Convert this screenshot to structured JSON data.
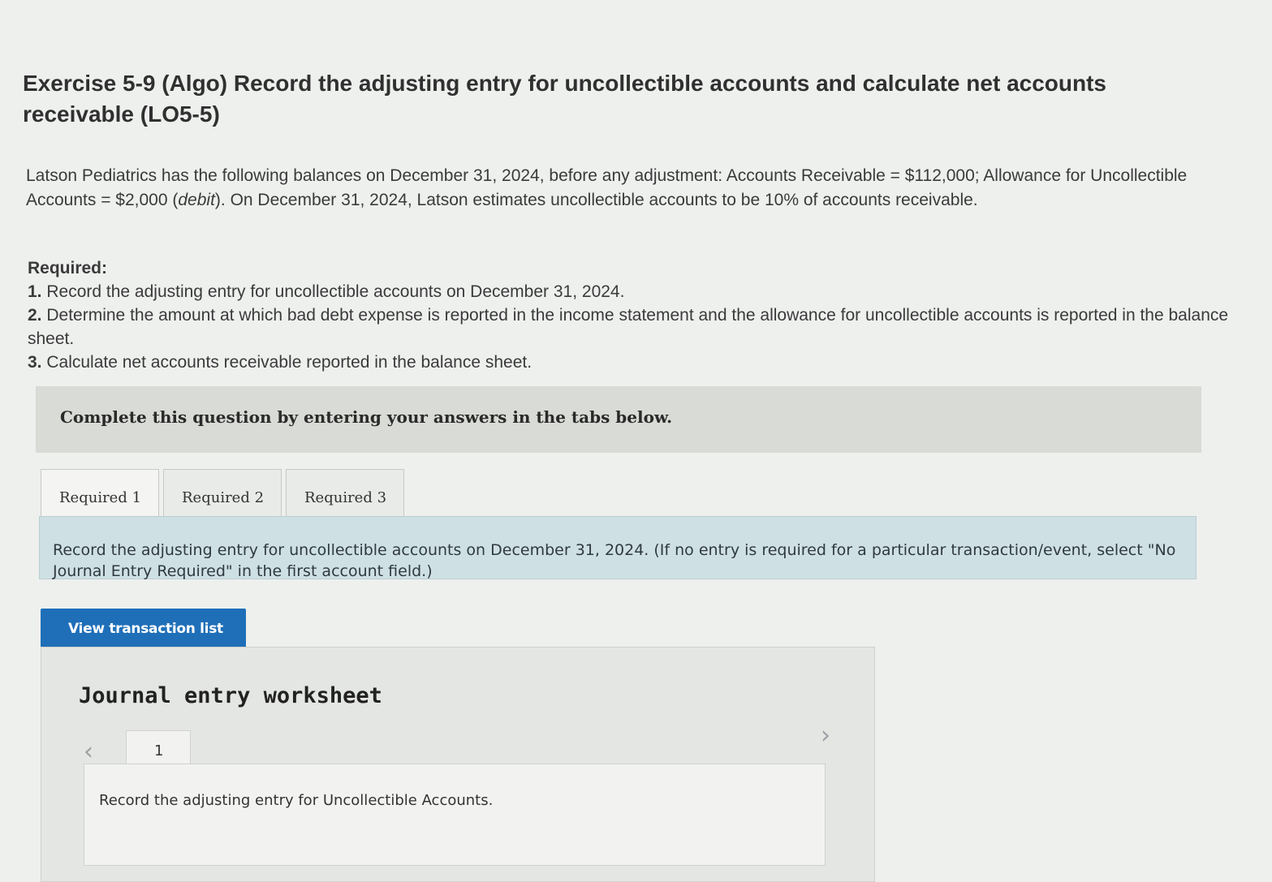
{
  "exercise": {
    "title": "Exercise 5-9 (Algo) Record the adjusting entry for uncollectible accounts and calculate net accounts receivable (LO5-5)",
    "intro_part1": "Latson Pediatrics has the following balances on December 31, 2024, before any adjustment: Accounts Receivable = $112,000; Allowance for Uncollectible Accounts = $2,000 (",
    "intro_italic": "debit",
    "intro_part2": "). On December 31, 2024, Latson estimates uncollectible accounts to be 10% of accounts receivable."
  },
  "required": {
    "heading": "Required:",
    "items": [
      {
        "num": "1.",
        "text": "Record the adjusting entry for uncollectible accounts on December 31, 2024."
      },
      {
        "num": "2.",
        "text": "Determine the amount at which bad debt expense is reported in the income statement and the allowance for uncollectible accounts is reported in the balance sheet."
      },
      {
        "num": "3.",
        "text": "Calculate net accounts receivable reported in the balance sheet."
      }
    ]
  },
  "banner": {
    "text": "Complete this question by entering your answers in the tabs below."
  },
  "tabs": [
    {
      "label": "Required 1",
      "active": true
    },
    {
      "label": "Required 2",
      "active": false
    },
    {
      "label": "Required 3",
      "active": false
    }
  ],
  "instruction": {
    "text": "Record the adjusting entry for uncollectible accounts on December 31, 2024. (If no entry is required for a particular transaction/event, select \"No Journal Entry Required\" in the first account field.)"
  },
  "buttons": {
    "view_transaction_list": "View transaction list"
  },
  "worksheet": {
    "title": "Journal entry worksheet",
    "page_number": "1",
    "entry_text": "Record the adjusting entry for Uncollectible Accounts.",
    "prev_icon": "chevron-left-icon",
    "next_icon": "chevron-right-icon"
  },
  "colors": {
    "primary_button": "#1f6fb8",
    "instruction_bg": "#cfe0e4",
    "banner_bg": "#d9dbd6"
  }
}
